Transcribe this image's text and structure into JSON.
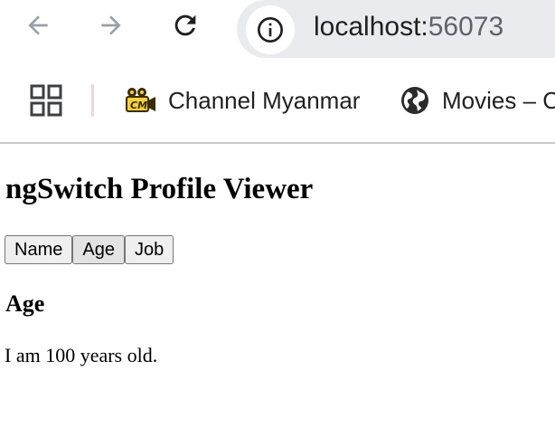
{
  "browser": {
    "url_host": "localhost:",
    "url_port": "56073",
    "bookmarks": [
      {
        "label": "Channel Myanmar",
        "icon": "film-camera-icon"
      },
      {
        "label": "Movies – C",
        "icon": "globe-icon"
      }
    ]
  },
  "page": {
    "title": "ngSwitch Profile Viewer",
    "buttons": {
      "name": "Name",
      "age": "Age",
      "job": "Job"
    },
    "active_button": "Age",
    "section_title": "Age",
    "section_text": "I am 100 years old."
  },
  "colors": {
    "omnibox_bg": "#e9ebee",
    "text": "#1f1f1f",
    "icon_gray": "#9aa0a6",
    "port_gray": "#5f6368"
  }
}
